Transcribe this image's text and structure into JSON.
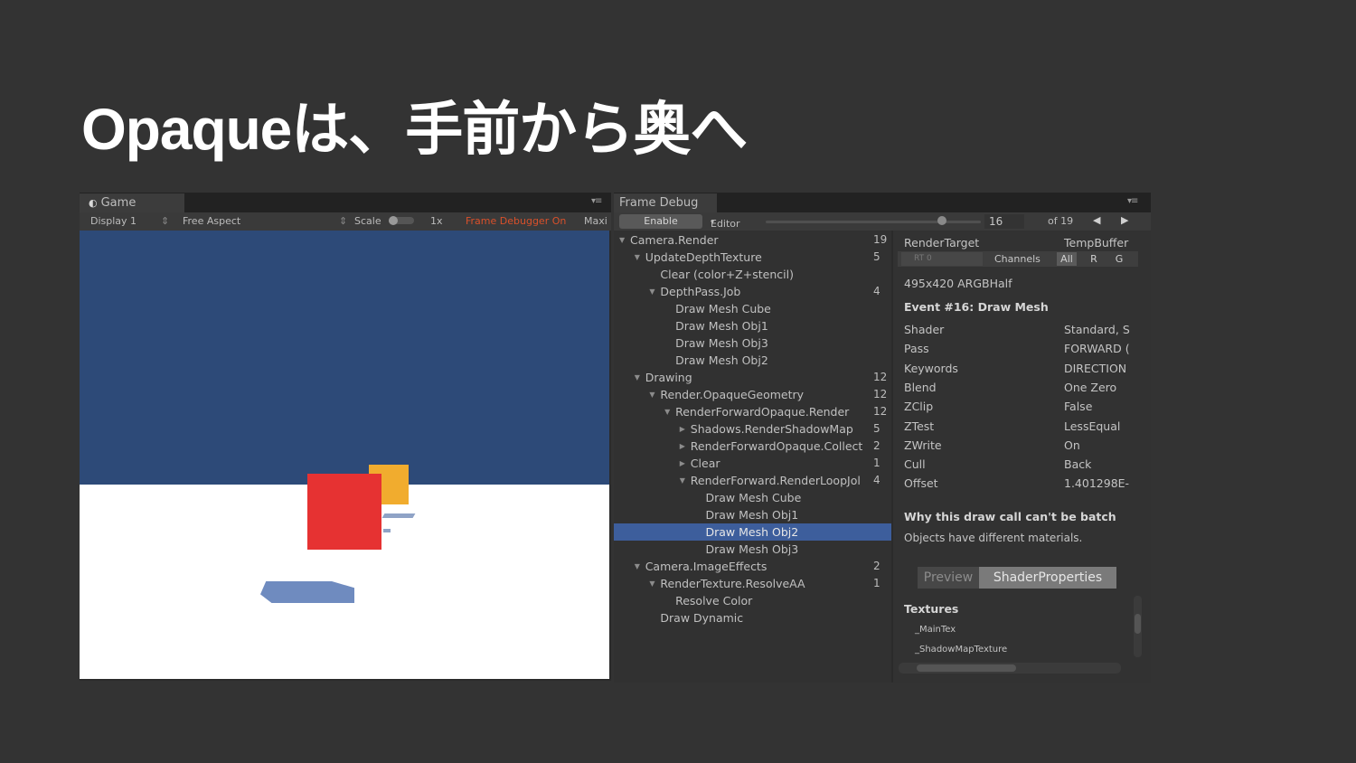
{
  "slide": {
    "title": "Opaqueは、手前から奥へ"
  },
  "game": {
    "tab_label": "Game",
    "display": "Display 1",
    "aspect": "Free Aspect",
    "scale_label": "Scale",
    "scale_value": "1x",
    "frame_debugger_status": "Frame Debugger On",
    "maximize_label": "Maxi",
    "colors": {
      "sky": "#2d4a78",
      "ground": "#ffffff",
      "red_cube": "#e63232",
      "yellow_cube": "#f1ac2e",
      "shadow": "#6f8bbf"
    }
  },
  "frame_debug": {
    "tab_label": "Frame Debug",
    "enable_label": "Enable",
    "editor_label": "Editor",
    "current_event": "16",
    "of_total": "of 19",
    "tree": [
      {
        "label": "Camera.Render",
        "count": "19",
        "depth": 0,
        "expanded": true,
        "selected": false
      },
      {
        "label": "UpdateDepthTexture",
        "count": "5",
        "depth": 1,
        "expanded": true,
        "selected": false
      },
      {
        "label": "Clear (color+Z+stencil)",
        "count": "",
        "depth": 2,
        "expanded": null,
        "selected": false
      },
      {
        "label": "DepthPass.Job",
        "count": "4",
        "depth": 2,
        "expanded": true,
        "selected": false
      },
      {
        "label": "Draw Mesh Cube",
        "count": "",
        "depth": 3,
        "expanded": null,
        "selected": false
      },
      {
        "label": "Draw Mesh Obj1",
        "count": "",
        "depth": 3,
        "expanded": null,
        "selected": false
      },
      {
        "label": "Draw Mesh Obj3",
        "count": "",
        "depth": 3,
        "expanded": null,
        "selected": false
      },
      {
        "label": "Draw Mesh Obj2",
        "count": "",
        "depth": 3,
        "expanded": null,
        "selected": false
      },
      {
        "label": "Drawing",
        "count": "12",
        "depth": 1,
        "expanded": true,
        "selected": false
      },
      {
        "label": "Render.OpaqueGeometry",
        "count": "12",
        "depth": 2,
        "expanded": true,
        "selected": false
      },
      {
        "label": "RenderForwardOpaque.Render",
        "count": "12",
        "depth": 3,
        "expanded": true,
        "selected": false
      },
      {
        "label": "Shadows.RenderShadowMap",
        "count": "5",
        "depth": 4,
        "expanded": false,
        "selected": false
      },
      {
        "label": "RenderForwardOpaque.Collect",
        "count": "2",
        "depth": 4,
        "expanded": false,
        "selected": false
      },
      {
        "label": "Clear",
        "count": "1",
        "depth": 4,
        "expanded": false,
        "selected": false
      },
      {
        "label": "RenderForward.RenderLoopJol",
        "count": "4",
        "depth": 4,
        "expanded": true,
        "selected": false
      },
      {
        "label": "Draw Mesh Cube",
        "count": "",
        "depth": 5,
        "expanded": null,
        "selected": false
      },
      {
        "label": "Draw Mesh Obj1",
        "count": "",
        "depth": 5,
        "expanded": null,
        "selected": false
      },
      {
        "label": "Draw Mesh Obj2",
        "count": "",
        "depth": 5,
        "expanded": null,
        "selected": true
      },
      {
        "label": "Draw Mesh Obj3",
        "count": "",
        "depth": 5,
        "expanded": null,
        "selected": false
      },
      {
        "label": "Camera.ImageEffects",
        "count": "2",
        "depth": 1,
        "expanded": true,
        "selected": false
      },
      {
        "label": "RenderTexture.ResolveAA",
        "count": "1",
        "depth": 2,
        "expanded": true,
        "selected": false
      },
      {
        "label": "Resolve Color",
        "count": "",
        "depth": 3,
        "expanded": null,
        "selected": false
      },
      {
        "label": "Draw Dynamic",
        "count": "",
        "depth": 2,
        "expanded": null,
        "selected": false
      }
    ],
    "details": {
      "render_target_label": "RenderTarget",
      "render_target_value": "TempBuffer",
      "rt_dropdown": "RT 0",
      "channels_label": "Channels",
      "channel_buttons": [
        "All",
        "R",
        "G"
      ],
      "format": "495x420 ARGBHalf",
      "event_title": "Event #16: Draw Mesh",
      "props": [
        {
          "key": "Shader",
          "value": "Standard, S"
        },
        {
          "key": "Pass",
          "value": "FORWARD ("
        },
        {
          "key": "Keywords",
          "value": "DIRECTION"
        },
        {
          "key": "Blend",
          "value": "One Zero"
        },
        {
          "key": "ZClip",
          "value": "False"
        },
        {
          "key": "ZTest",
          "value": "LessEqual"
        },
        {
          "key": "ZWrite",
          "value": "On"
        },
        {
          "key": "Cull",
          "value": "Back"
        },
        {
          "key": "Offset",
          "value": "1.401298E-"
        }
      ],
      "batch_heading": "Why this draw call can't be batch",
      "batch_reason": "Objects have different materials.",
      "tab_preview": "Preview",
      "tab_shader_props": "ShaderProperties",
      "textures_heading": "Textures",
      "textures": [
        "_MainTex",
        "_ShadowMapTexture"
      ]
    }
  }
}
